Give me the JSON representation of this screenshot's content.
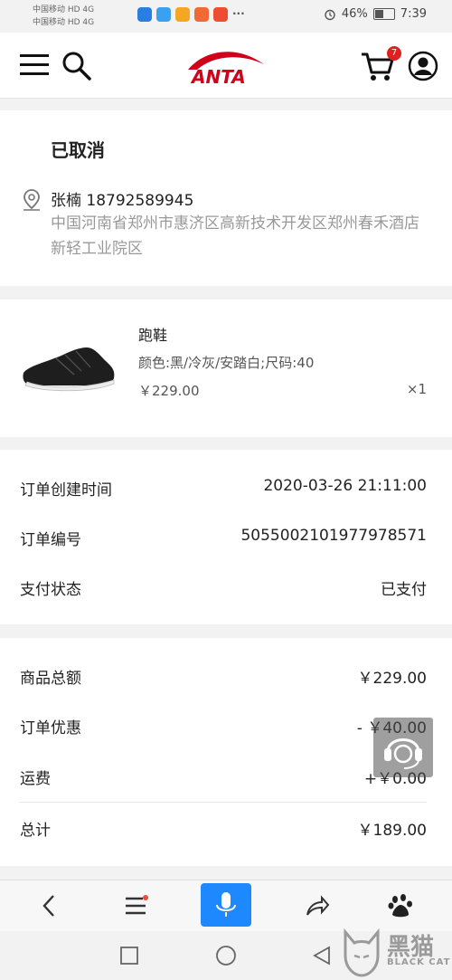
{
  "status_bar": {
    "carrier_1": "中国移动 HD 4G",
    "carrier_2": "中国移动 HD 4G",
    "battery": "46%",
    "time": "7:39",
    "overflow": "···"
  },
  "header": {
    "logo_text": "ANTA",
    "cart_count": "7"
  },
  "order": {
    "status": "已取消",
    "recipient": "张楠 18792589945",
    "address": "中国河南省郑州市惠济区高新技术开发区郑州春禾酒店新轻工业院区"
  },
  "product": {
    "name": "跑鞋",
    "spec": "颜色:黑/冷灰/安踏白;尺码:40",
    "price": "￥229.00",
    "qty": "×1"
  },
  "order_info": {
    "created_label": "订单创建时间",
    "created_value": "2020-03-26 21:11:00",
    "number_label": "订单编号",
    "number_value": "5055002101977978571",
    "pay_label": "支付状态",
    "pay_value": "已支付"
  },
  "amounts": {
    "goods_label": "商品总额",
    "goods_value": "￥229.00",
    "discount_label": "订单优惠",
    "discount_value": "- ￥40.00",
    "shipping_label": "运费",
    "shipping_value": "+￥0.00",
    "total_label": "总计",
    "total_value": "￥189.00"
  },
  "watermark": {
    "title": "黑猫",
    "subtitle": "BLACK CAT"
  },
  "colors": {
    "brand": "#d0021b",
    "mic": "#1e88ff",
    "badge": "#e02020"
  }
}
